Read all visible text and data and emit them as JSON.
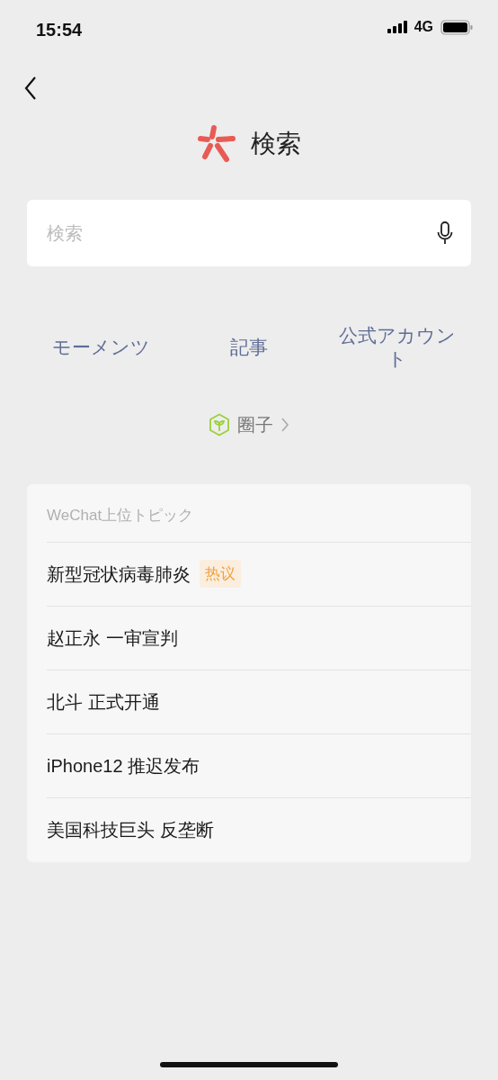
{
  "status_bar": {
    "time": "15:54",
    "network": "4G"
  },
  "title": "検索",
  "search": {
    "placeholder": "検索"
  },
  "categories": [
    "モーメンツ",
    "記事",
    "公式アカウント"
  ],
  "circle_link": {
    "label": "圈子"
  },
  "topics": {
    "header": "WeChat上位トピック",
    "items": [
      {
        "text": "新型冠状病毒肺炎",
        "badge": "热议"
      },
      {
        "text": "赵正永 一审宣判"
      },
      {
        "text": "北斗 正式开通"
      },
      {
        "text": "iPhone12 推迟发布"
      },
      {
        "text": "美国科技巨头 反垄断"
      }
    ]
  }
}
